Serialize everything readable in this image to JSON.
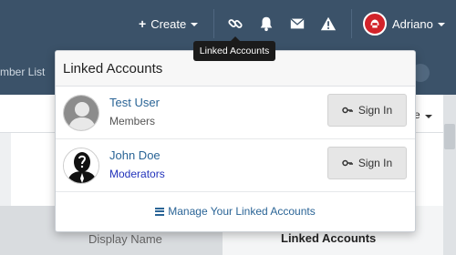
{
  "navbar": {
    "create_label": "Create",
    "user_name": "Adriano",
    "icons": [
      "link-icon",
      "bell-icon",
      "envelope-icon",
      "warning-icon"
    ]
  },
  "page": {
    "subbar_text": "mber List",
    "table_headers": [
      "Display Name",
      "Linked Accounts"
    ]
  },
  "tooltip": {
    "text": "Linked Accounts"
  },
  "popup": {
    "title": "Linked Accounts",
    "accounts": [
      {
        "name": "Test User",
        "group": "Members",
        "signin_label": "Sign In"
      },
      {
        "name": "John Doe",
        "group": "Moderators",
        "signin_label": "Sign In"
      }
    ],
    "footer_label": "Manage Your Linked Accounts"
  },
  "colors": {
    "navbar": "#3b5269",
    "link": "#2a6496",
    "moderators": "#2233bb",
    "user_avatar": "#d2232a"
  }
}
